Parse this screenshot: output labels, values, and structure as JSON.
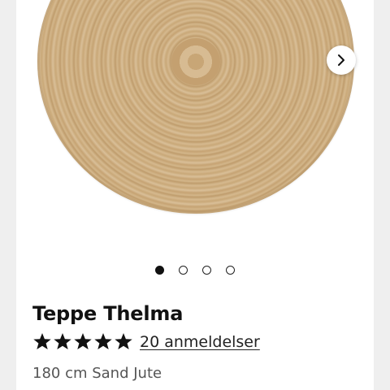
{
  "product": {
    "title": "Teppe Thelma",
    "rating": 5,
    "rating_max": 5,
    "reviews_label": "20 anmeldelser",
    "variant": "180 cm Sand Jute"
  },
  "gallery": {
    "image_count": 4,
    "active_index": 0,
    "next_icon": "chevron-right-icon"
  },
  "colors": {
    "page_background": "#efefef",
    "card_background": "#ffffff",
    "text_primary": "#111111",
    "text_secondary": "#555555",
    "star": "#111111"
  }
}
